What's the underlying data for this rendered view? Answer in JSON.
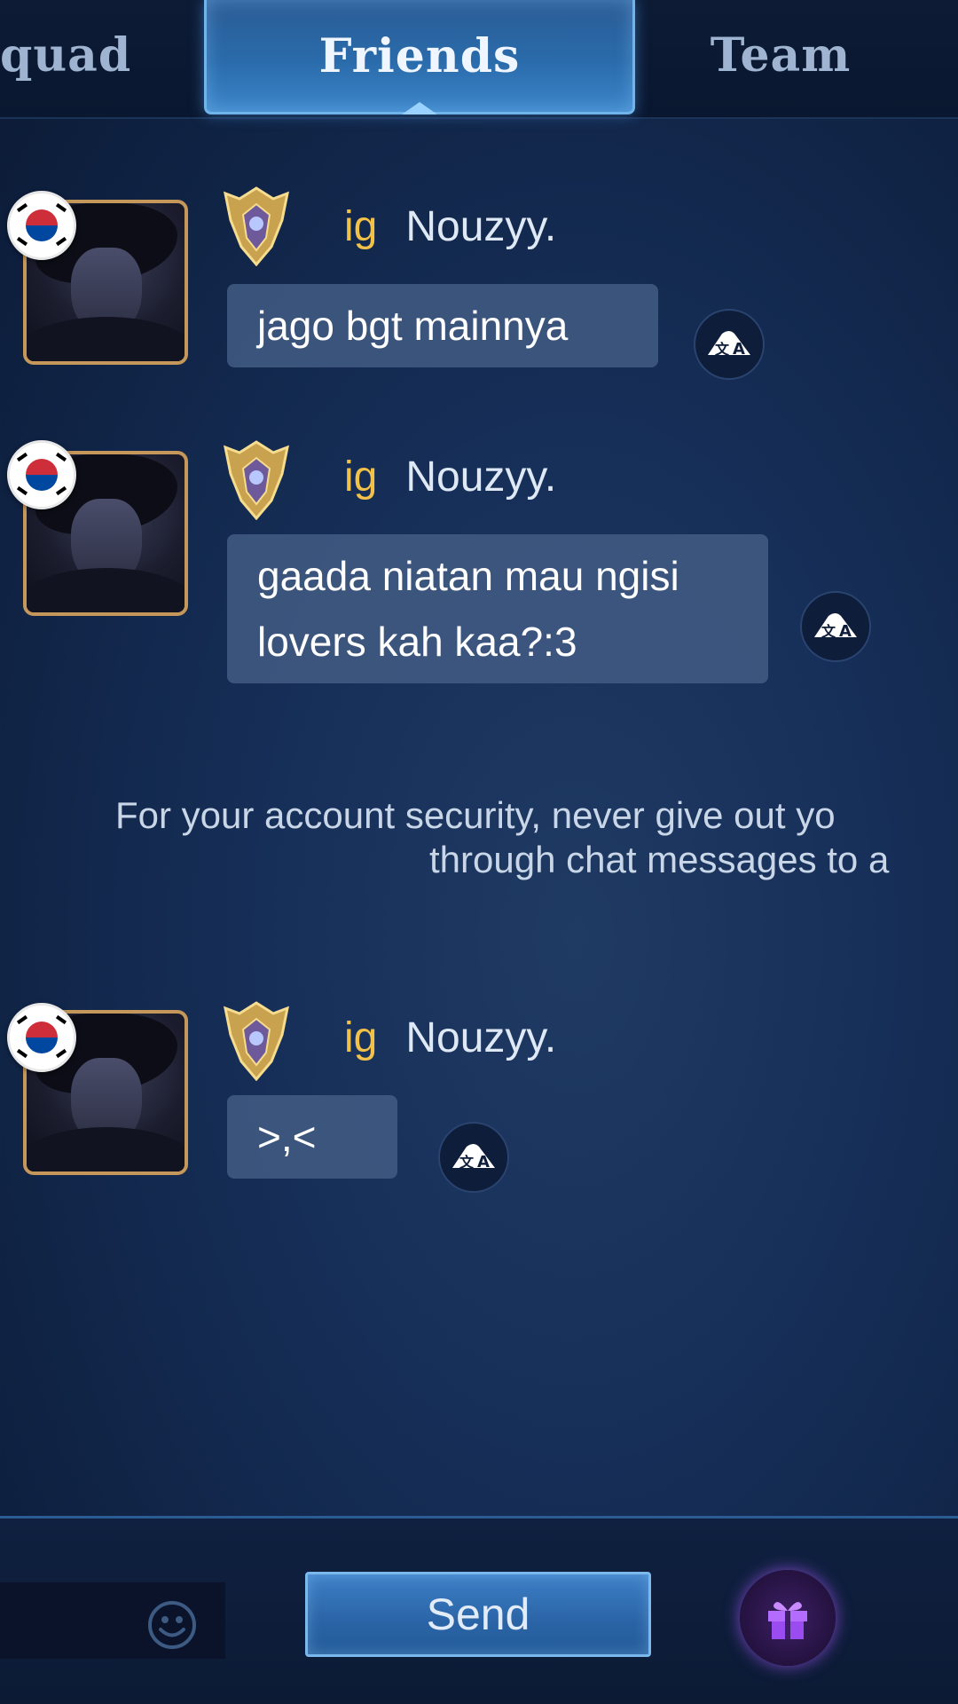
{
  "tabs": [
    {
      "label": "quad",
      "active": false
    },
    {
      "label": "Friends",
      "active": true
    },
    {
      "label": "Team",
      "active": false
    }
  ],
  "messages": [
    {
      "prefix": "ig",
      "name": "Nouzyy.",
      "lines": [
        "jago bgt mainnya"
      ]
    },
    {
      "prefix": "ig",
      "name": "Nouzyy.",
      "lines": [
        "gaada niatan mau ngisi",
        "lovers kah kaa?:3"
      ]
    },
    {
      "prefix": "ig",
      "name": "Nouzyy.",
      "lines": [
        ">,<"
      ]
    }
  ],
  "notice": {
    "line1": "For your account security, never give out yo",
    "line2": "through chat messages to a"
  },
  "bottom": {
    "send_label": "Send"
  },
  "icons": {
    "flag": "south-korea-flag-icon",
    "rank": "mythic-rank-emblem-icon",
    "translate": "translate-icon",
    "emoji": "emoji-icon",
    "gift": "gift-icon"
  },
  "colors": {
    "name_prefix": "#f2c14a",
    "active_tab": "#2a6bab",
    "avatar_border": "#c5975a",
    "gift_glow": "#aa5aff"
  }
}
